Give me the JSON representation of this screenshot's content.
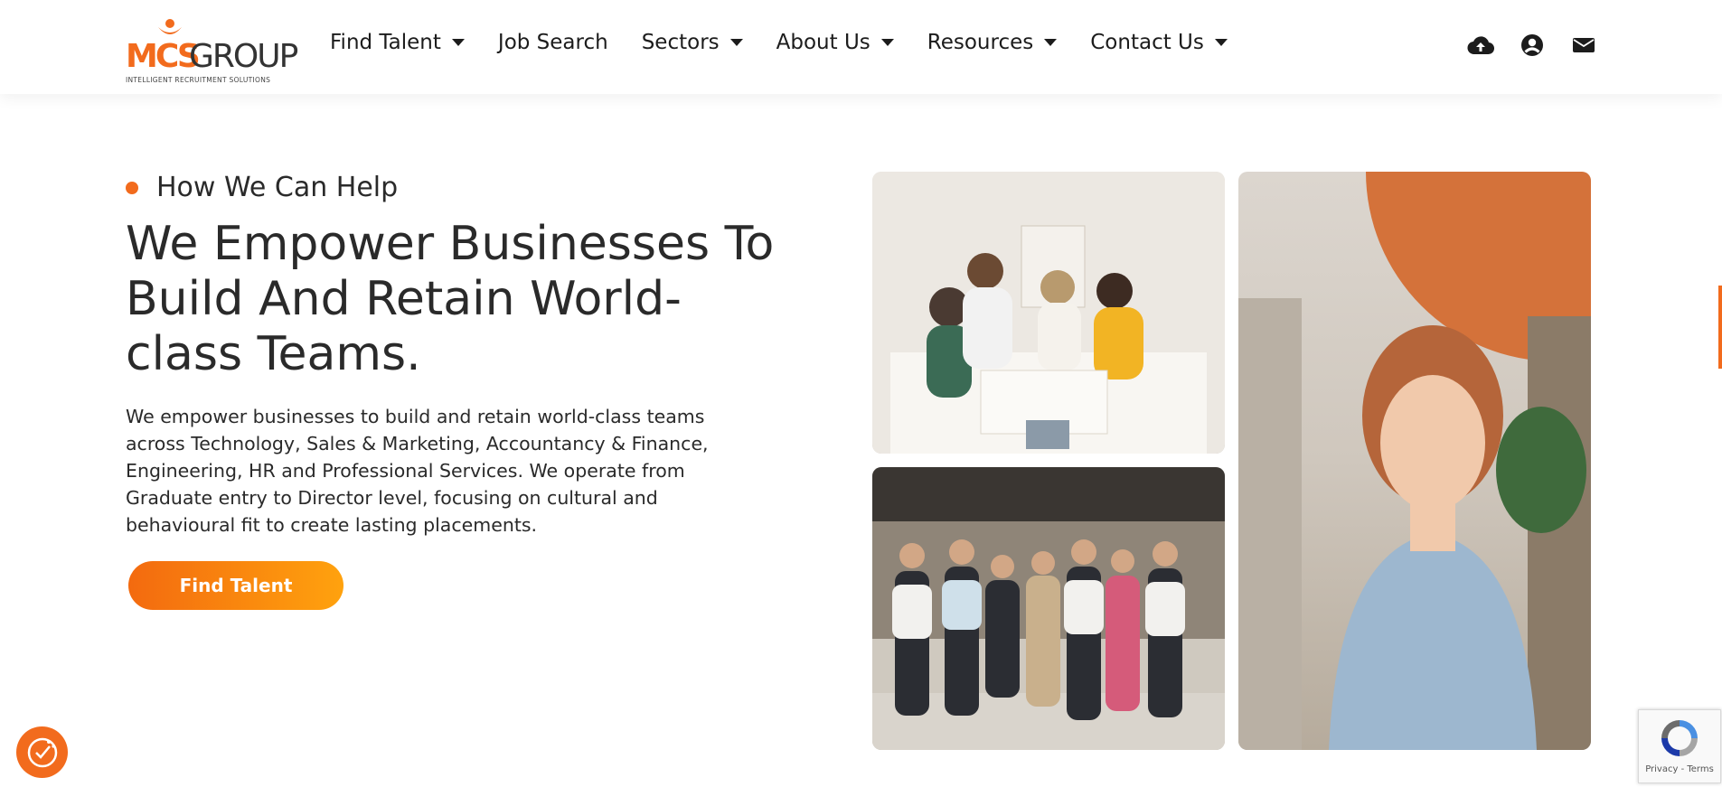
{
  "header": {
    "logo": {
      "brand_mcs": "MCS",
      "brand_group": "GROUP",
      "tagline": "INTELLIGENT RECRUITMENT SOLUTIONS"
    },
    "nav": [
      {
        "label": "Find Talent",
        "has_dropdown": true
      },
      {
        "label": "Job Search",
        "has_dropdown": false
      },
      {
        "label": "Sectors",
        "has_dropdown": true
      },
      {
        "label": "About Us",
        "has_dropdown": true
      },
      {
        "label": "Resources",
        "has_dropdown": true
      },
      {
        "label": "Contact Us",
        "has_dropdown": true
      }
    ],
    "icons": [
      "cloud-upload-icon",
      "user-circle-icon",
      "envelope-icon"
    ]
  },
  "hero": {
    "eyebrow": "How We Can Help",
    "headline": "We Empower Businesses To Build And Retain World-class Teams.",
    "body": "We empower businesses to build and retain world-class teams across Technology, Sales & Marketing, Accountancy & Finance, Engineering, HR and Professional Services. We operate from Graduate entry to Director level, focusing on cultural and behavioural fit to create lasting placements.",
    "cta_label": "Find Talent"
  },
  "recaptcha": {
    "links": "Privacy - Terms"
  },
  "colors": {
    "accent": "#f26b1d",
    "cta_gradient_start": "#f36a0f",
    "cta_gradient_end": "#ffa20e",
    "text": "#2a2a2a"
  }
}
